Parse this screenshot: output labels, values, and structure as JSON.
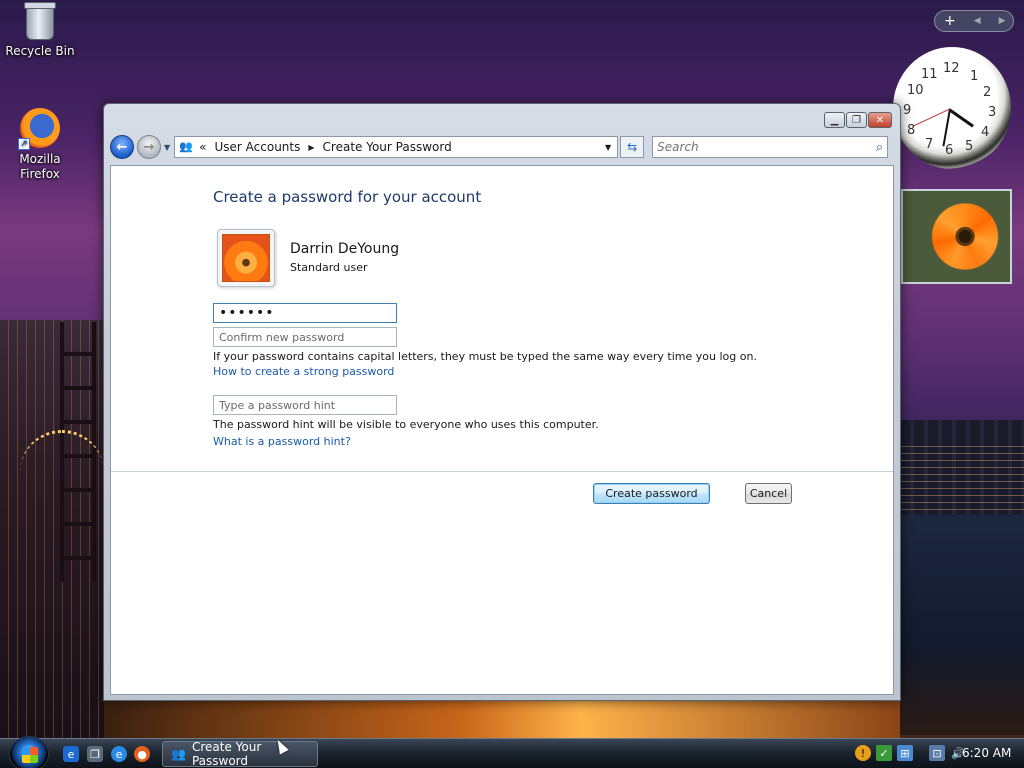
{
  "desktop": {
    "icons": [
      {
        "label": "Recycle Bin",
        "icon": "recycle-bin-icon"
      },
      {
        "label": "Mozilla\nFirefox",
        "icon": "firefox-icon"
      }
    ],
    "clock_numbers": [
      "12",
      "1",
      "2",
      "3",
      "4",
      "5",
      "6",
      "7",
      "8",
      "9",
      "10",
      "11"
    ]
  },
  "window": {
    "title": "Create Your Password",
    "address": {
      "prefix": "«",
      "crumbs": [
        "User Accounts",
        "Create Your Password"
      ]
    },
    "search": {
      "placeholder": "Search"
    }
  },
  "page": {
    "title": "Create a password for your account",
    "user": {
      "name": "Darrin DeYoung",
      "role": "Standard user"
    },
    "new_password": {
      "value": "••••••"
    },
    "confirm_password": {
      "placeholder": "Confirm new password"
    },
    "caps_note": "If your password contains capital letters, they must be typed the same way every time you log on.",
    "strong_password_link": "How to create a strong password",
    "hint": {
      "placeholder": "Type a password hint"
    },
    "hint_note": "The password hint will be visible to everyone who uses this computer.",
    "hint_link": "What is a password hint?",
    "buttons": {
      "create": "Create password",
      "cancel": "Cancel"
    }
  },
  "taskbar": {
    "task_label": "Create Your Password",
    "time": "6:20 AM"
  },
  "colors": {
    "title_blue": "#1e3a6a",
    "link_blue": "#1a5aa8",
    "focus_border": "#3c7fb1"
  }
}
